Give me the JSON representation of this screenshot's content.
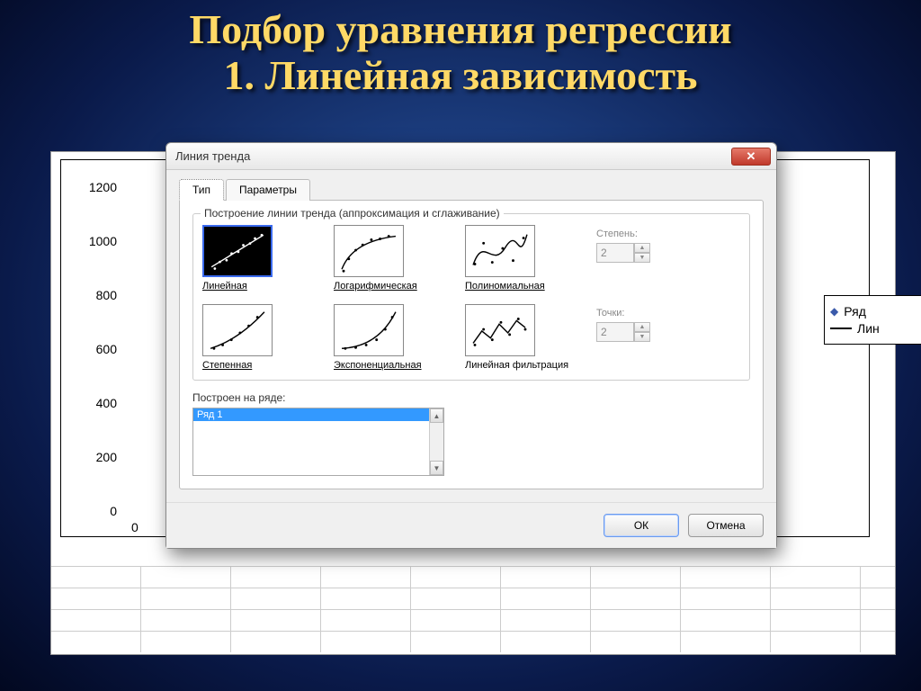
{
  "slide": {
    "title_line1": "Подбор  уравнения регрессии",
    "title_line2": "1. Линейная зависимость"
  },
  "chart": {
    "y_ticks": [
      "0",
      "200",
      "400",
      "600",
      "800",
      "1000",
      "1200"
    ],
    "x_start": "0",
    "legend": {
      "series": "Ряд",
      "trend": "Лин"
    }
  },
  "dialog": {
    "title": "Линия тренда",
    "tabs": {
      "type": "Тип",
      "params": "Параметры"
    },
    "fieldset_label": "Построение линии тренда (аппроксимация и сглаживание)",
    "options": {
      "linear": "Линейная",
      "log": "Логарифмическая",
      "poly": "Полиномиальная",
      "power": "Степенная",
      "exp": "Экспоненциальная",
      "movavg": "Линейная фильтрация"
    },
    "degree_label": "Степень:",
    "degree_value": "2",
    "points_label": "Точки:",
    "points_value": "2",
    "series_label": "Построен на ряде:",
    "series_item": "Ряд 1",
    "ok": "ОК",
    "cancel": "Отмена"
  },
  "chart_data": {
    "type": "scatter",
    "title": "",
    "xlabel": "",
    "ylabel": "",
    "ylim": [
      0,
      1200
    ],
    "y_ticks": [
      0,
      200,
      400,
      600,
      800,
      1000,
      1200
    ],
    "series": [
      {
        "name": "Ряд 1",
        "note": "data points hidden behind dialog; not visible in screenshot"
      }
    ],
    "trendline": {
      "type": "linear",
      "name": "Линейная"
    }
  }
}
